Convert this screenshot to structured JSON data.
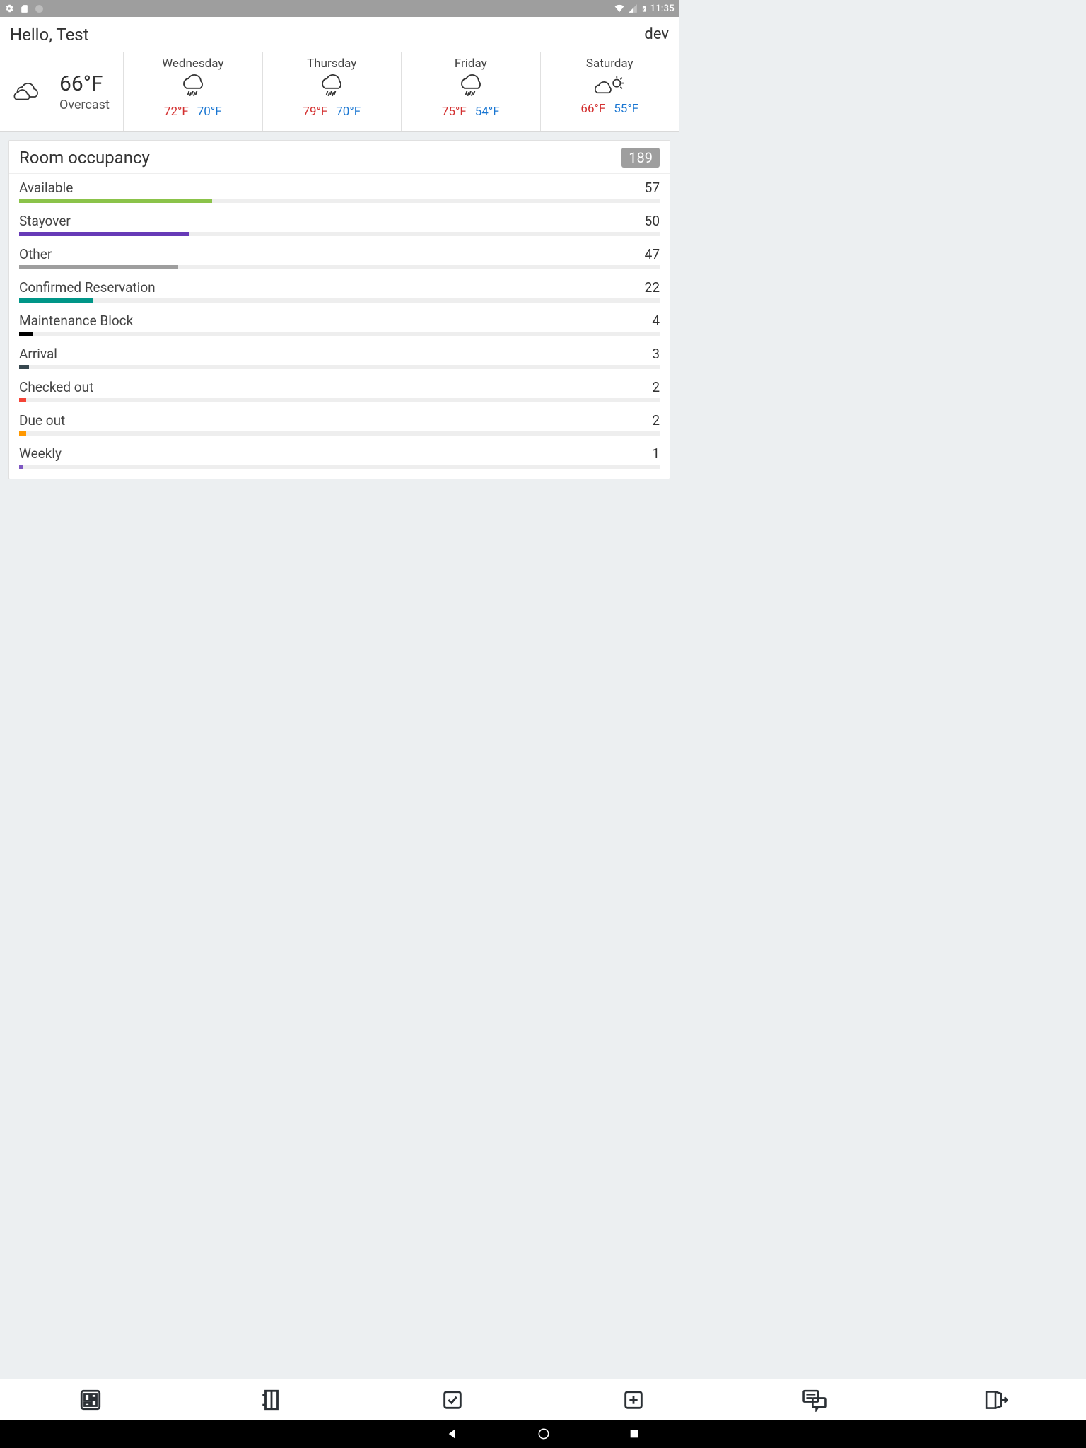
{
  "status": {
    "time": "11:35"
  },
  "header": {
    "greeting": "Hello, Test",
    "env": "dev"
  },
  "weather": {
    "now": {
      "temp": "66°F",
      "condition": "Overcast"
    },
    "forecast": [
      {
        "day": "Wednesday",
        "icon": "rain",
        "hi": "72°F",
        "lo": "70°F"
      },
      {
        "day": "Thursday",
        "icon": "rain",
        "hi": "79°F",
        "lo": "70°F"
      },
      {
        "day": "Friday",
        "icon": "rain",
        "hi": "75°F",
        "lo": "54°F"
      },
      {
        "day": "Saturday",
        "icon": "partly",
        "hi": "66°F",
        "lo": "55°F"
      }
    ]
  },
  "occupancy": {
    "title": "Room occupancy",
    "total": "189",
    "rows": [
      {
        "label": "Available",
        "value": 57,
        "color": "#8bc34a"
      },
      {
        "label": "Stayover",
        "value": 50,
        "color": "#673ab7"
      },
      {
        "label": "Other",
        "value": 47,
        "color": "#9e9e9e"
      },
      {
        "label": "Confirmed Reservation",
        "value": 22,
        "color": "#009688"
      },
      {
        "label": "Maintenance Block",
        "value": 4,
        "color": "#000000"
      },
      {
        "label": "Arrival",
        "value": 3,
        "color": "#37474f"
      },
      {
        "label": "Checked out",
        "value": 2,
        "color": "#f44336"
      },
      {
        "label": "Due out",
        "value": 2,
        "color": "#ff9800"
      },
      {
        "label": "Weekly",
        "value": 1,
        "color": "#7e57c2"
      }
    ]
  },
  "chart_data": {
    "type": "bar",
    "title": "Room occupancy",
    "categories": [
      "Available",
      "Stayover",
      "Other",
      "Confirmed Reservation",
      "Maintenance Block",
      "Arrival",
      "Checked out",
      "Due out",
      "Weekly"
    ],
    "values": [
      57,
      50,
      47,
      22,
      4,
      3,
      2,
      2,
      1
    ],
    "total": 189,
    "xlabel": "",
    "ylabel": "",
    "ylim": [
      0,
      189
    ]
  }
}
